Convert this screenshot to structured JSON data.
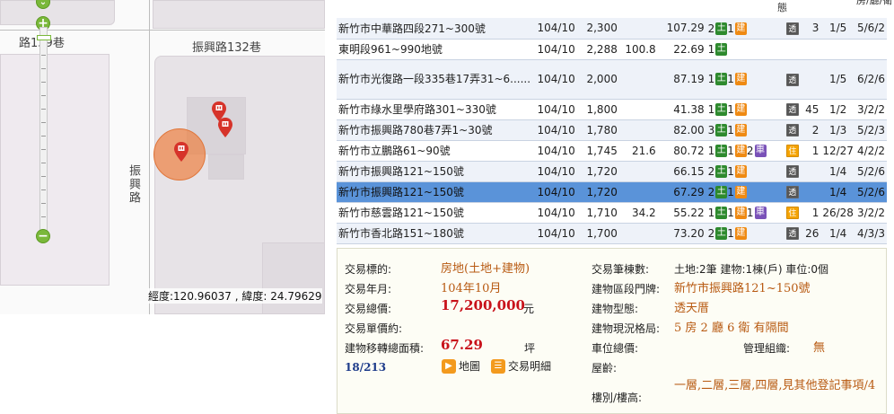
{
  "map": {
    "labels": {
      "lane139": "路139巷",
      "lane132": "振興路132巷",
      "road_vertical": "振興路"
    },
    "zoom": {
      "plus": "+",
      "minus": "−"
    },
    "coordinates": "經度:120.96037 , 緯度: 24.79629"
  },
  "table": {
    "header_fragments": {
      "type": "態",
      "layout": "房/廳/衛"
    },
    "rows": [
      {
        "address": "新竹市中華路四段271~300號",
        "date": "104/10",
        "total_price": "2,300",
        "unit_price": "",
        "area": "107.29",
        "land": "2",
        "bld": "1",
        "car": "",
        "type_badge": "透",
        "age": "3",
        "floor": "1/5",
        "layout": "5/6/2",
        "style": "odd"
      },
      {
        "address": "東明段961~990地號",
        "date": "104/10",
        "total_price": "2,288",
        "unit_price": "100.8",
        "area": "22.69",
        "land": "1",
        "bld": "",
        "car": "",
        "type_badge": "",
        "age": "",
        "floor": "",
        "layout": "",
        "style": "even"
      },
      {
        "address": "新竹市光復路一段335巷17弄31~6......",
        "date": "104/10",
        "total_price": "2,000",
        "unit_price": "",
        "area": "87.19",
        "land": "1",
        "bld": "1",
        "car": "",
        "type_badge": "透",
        "age": "",
        "floor": "1/5",
        "layout": "6/2/6",
        "style": "odd tall"
      },
      {
        "address": "新竹市綠水里學府路301~330號",
        "date": "104/10",
        "total_price": "1,800",
        "unit_price": "",
        "area": "41.38",
        "land": "1",
        "bld": "1",
        "car": "",
        "type_badge": "透",
        "age": "45",
        "floor": "1/2",
        "layout": "3/2/2",
        "style": "even"
      },
      {
        "address": "新竹市振興路780巷7弄1~30號",
        "date": "104/10",
        "total_price": "1,780",
        "unit_price": "",
        "area": "82.00",
        "land": "3",
        "bld": "1",
        "car": "",
        "type_badge": "透",
        "age": "2",
        "floor": "1/3",
        "layout": "5/2/3",
        "style": "odd"
      },
      {
        "address": "新竹市立鵬路61~90號",
        "date": "104/10",
        "total_price": "1,745",
        "unit_price": "21.6",
        "area": "80.72",
        "land": "1",
        "bld": "1",
        "car": "2",
        "type_badge": "住",
        "age": "1",
        "floor": "12/27",
        "layout": "4/2/2",
        "style": "even"
      },
      {
        "address": "新竹市振興路121~150號",
        "date": "104/10",
        "total_price": "1,720",
        "unit_price": "",
        "area": "66.15",
        "land": "2",
        "bld": "1",
        "car": "",
        "type_badge": "透",
        "age": "",
        "floor": "1/4",
        "layout": "5/2/6",
        "style": "odd"
      },
      {
        "address": "新竹市振興路121~150號",
        "date": "104/10",
        "total_price": "1,720",
        "unit_price": "",
        "area": "67.29",
        "land": "2",
        "bld": "1",
        "car": "",
        "type_badge": "透",
        "age": "",
        "floor": "1/4",
        "layout": "5/2/6",
        "style": "selected"
      },
      {
        "address": "新竹市慈雲路121~150號",
        "date": "104/10",
        "total_price": "1,710",
        "unit_price": "34.2",
        "area": "55.22",
        "land": "1",
        "bld": "1",
        "car": "1",
        "type_badge": "住",
        "age": "1",
        "floor": "26/28",
        "layout": "3/2/2",
        "style": "even"
      },
      {
        "address": "新竹市香北路151~180號",
        "date": "104/10",
        "total_price": "1,700",
        "unit_price": "",
        "area": "73.20",
        "land": "2",
        "bld": "1",
        "car": "",
        "type_badge": "透",
        "age": "26",
        "floor": "1/4",
        "layout": "4/3/3",
        "style": "odd"
      }
    ],
    "tag_glyphs": {
      "land": "土",
      "bld": "建",
      "car": "車"
    }
  },
  "detail": {
    "labels": {
      "target": "交易標的:",
      "year_month": "交易年月:",
      "total_price": "交易總價:",
      "unit_price": "交易單價約:",
      "area": "建物移轉總面積:",
      "count": "交易筆棟數:",
      "door": "建物區段門牌:",
      "bld_type": "建物型態:",
      "layout": "建物現況格局:",
      "parking_price": "車位總價:",
      "mgmt": "管理組織:",
      "age": "屋齡:",
      "floor": "樓別/樓高:"
    },
    "values": {
      "target": "房地(土地+建物)",
      "year_month": "104年10月",
      "total_price": "17,200,000",
      "total_price_unit": "元",
      "area": "67.29",
      "area_unit": "坪",
      "count": "土地:2筆 建物:1棟(戶) 車位:0個",
      "door": "新竹市振興路121~150號",
      "bld_type": "透天厝",
      "layout": "5 房 2 廳 6 衛 有隔間",
      "mgmt": "無",
      "floor": "一層,二層,三層,四層,見其他登記事項/4"
    },
    "pager": "18/213",
    "actions": {
      "map": "地圖",
      "detail": "交易明細"
    }
  },
  "colors": {
    "selected_row": "#5a93d9",
    "accent_orange": "#b85a12",
    "price_red": "#c8111a",
    "land_tag": "#2e8a2e",
    "bld_tag": "#ef8a13"
  }
}
